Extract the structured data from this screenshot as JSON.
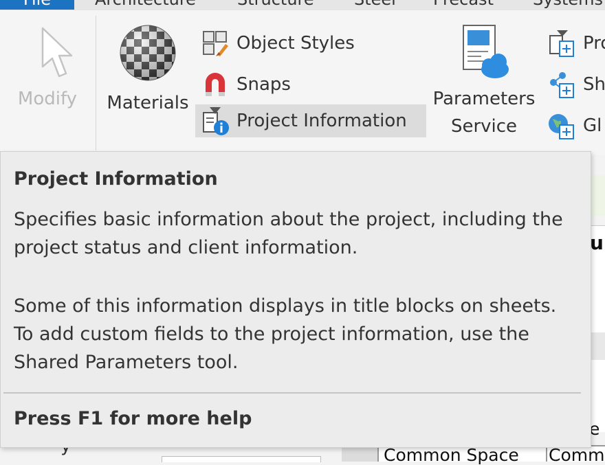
{
  "tabs": [
    "File",
    "Architecture",
    "Structure",
    "Steel",
    "Precast",
    "Systems"
  ],
  "ribbon": {
    "modify_label": "Modify",
    "materials_label": "Materials",
    "object_styles_label": "Object  Styles",
    "snaps_label": "Snaps",
    "project_information_label": "Project  Information",
    "parameters_service_line1": "Parameters",
    "parameters_service_line2": "Service",
    "right_items": [
      "Pro",
      "Sh",
      "Gl"
    ]
  },
  "background": {
    "heading_fragment": "du",
    "row_letter": "e",
    "cell1": "Common Space",
    "cell2": "Comme",
    "left_fragment": "y"
  },
  "tooltip": {
    "title": "Project Information",
    "paragraph1": "Specifies basic information about the project, including the project status and client information.",
    "paragraph2": "Some of this information displays in title blocks on sheets. To add custom fields to the project information, use the Shared Parameters tool.",
    "help": "Press F1 for more help"
  },
  "colors": {
    "file_tab": "#1c73c1",
    "tooltip_bg": "#ececec",
    "highlight": "#dcdcdc",
    "info_blue": "#1e7fd6",
    "snap_red": "#d9343a"
  }
}
